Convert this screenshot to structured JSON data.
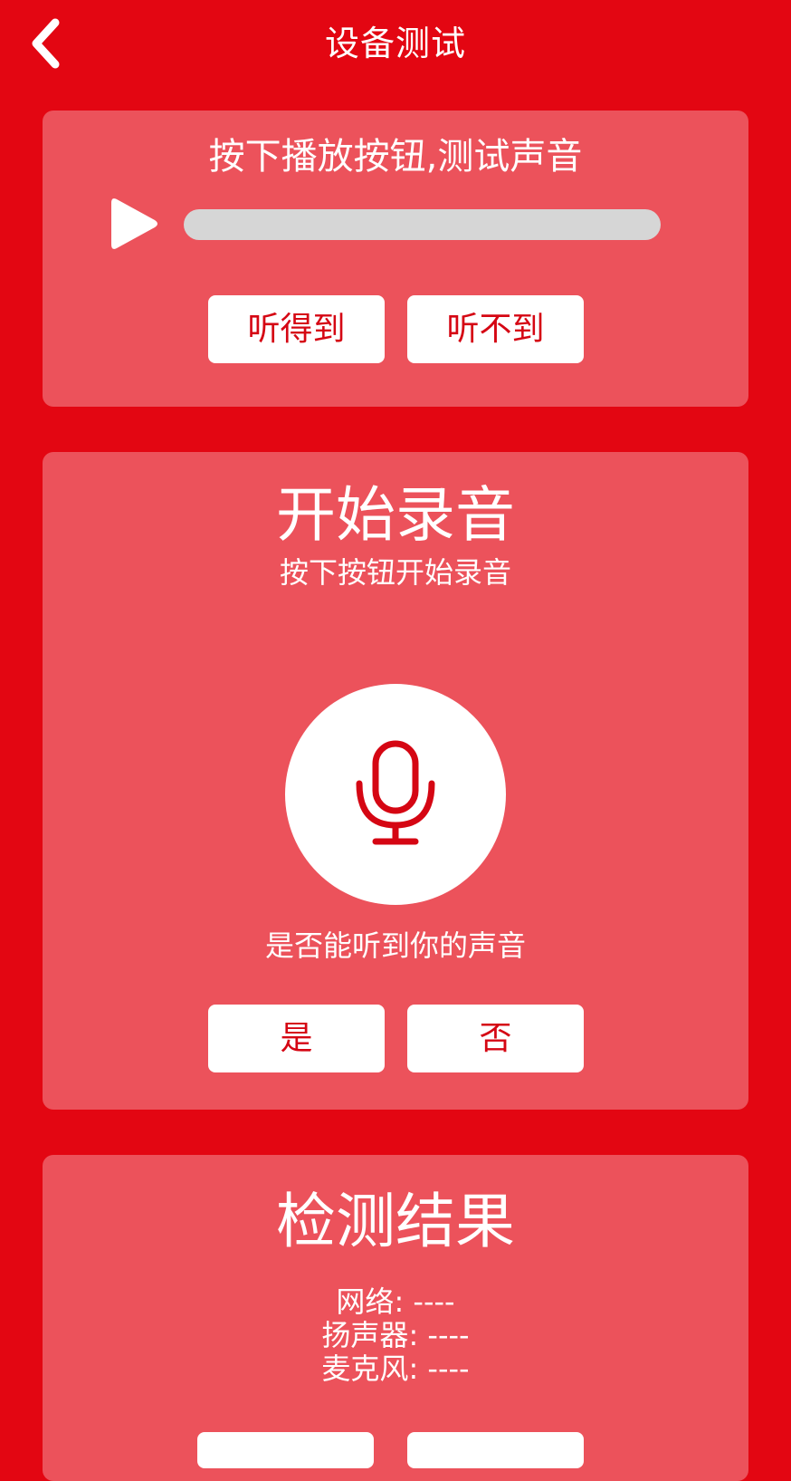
{
  "header": {
    "title": "设备测试",
    "back_icon": "chevron-left-icon"
  },
  "speaker_test": {
    "instruction": "按下播放按钮,测试声音",
    "play_icon": "play-icon",
    "progress": 0,
    "hear_button": "听得到",
    "cannot_hear_button": "听不到"
  },
  "mic_test": {
    "title": "开始录音",
    "subtitle": "按下按钮开始录音",
    "mic_icon": "microphone-icon",
    "question": "是否能听到你的声音",
    "yes_button": "是",
    "no_button": "否"
  },
  "results": {
    "title": "检测结果",
    "items": [
      {
        "label": "网络",
        "value": "----"
      },
      {
        "label": "扬声器",
        "value": "----"
      },
      {
        "label": "麦克风",
        "value": "----"
      }
    ]
  },
  "colors": {
    "background": "#e30612",
    "card": "#ec525b",
    "button_text": "#d50613",
    "progress_track": "#d6d6d6"
  }
}
